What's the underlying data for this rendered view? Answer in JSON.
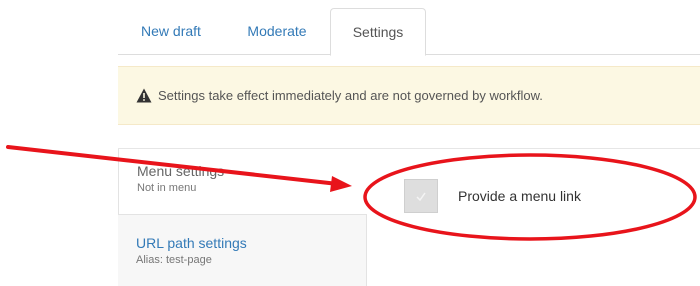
{
  "tabs": [
    {
      "label": "New draft"
    },
    {
      "label": "Moderate"
    },
    {
      "label": "Settings",
      "active": true
    }
  ],
  "alert": {
    "icon": "warning-icon",
    "text": "Settings take effect immediately and are not governed by workflow."
  },
  "vertical_tabs": [
    {
      "title": "Menu settings",
      "summary": "Not in menu",
      "active": true
    },
    {
      "title": "URL path settings",
      "summary": "Alias: test-page"
    }
  ],
  "menu_settings": {
    "checkbox_checked": false,
    "checkbox_icon": "check-icon",
    "label": "Provide a menu link"
  },
  "annotation": {
    "color": "#e8141b",
    "arrow": "red-arrow",
    "circle": "red-ellipse"
  },
  "colors": {
    "link": "#337ab7",
    "alert_bg": "#fcf8e3",
    "annotation": "#e8141b"
  }
}
